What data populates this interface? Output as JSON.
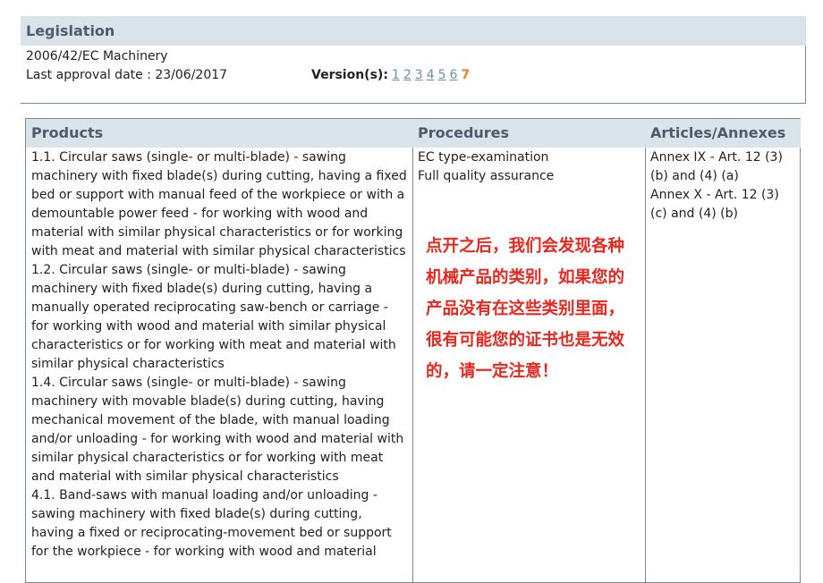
{
  "legislation": {
    "header": "Legislation",
    "directive": "2006/42/EC Machinery",
    "approval": "Last approval date : 23/06/2017",
    "versions_label": "Version(s):",
    "versions": [
      "1",
      "2",
      "3",
      "4",
      "5",
      "6"
    ],
    "current_version": "7"
  },
  "table": {
    "headers": {
      "products": "Products",
      "procedures": "Procedures",
      "articles": "Articles/Annexes"
    },
    "products": [
      "1.1. Circular saws (single- or multi-blade) - sawing machinery with fixed blade(s) during cutting, having a fixed bed or support with manual feed of the workpiece or with a demountable power feed - for working with wood and material with similar physical characteristics or for working with meat and material with similar physical characteristics",
      "1.2. Circular saws (single- or multi-blade) - sawing machinery with fixed blade(s) during cutting, having a manually operated reciprocating saw-bench or carriage - for working with wood and material with similar physical characteristics or for working with meat and material with similar physical characteristics",
      "1.4. Circular saws (single- or multi-blade) - sawing machinery with movable blade(s) during cutting, having mechanical movement of the blade, with manual loading and/or unloading - for working with wood and material with similar physical characteristics or for working with meat and material with similar physical characteristics",
      "4.1. Band-saws with manual loading and/or unloading - sawing machinery with fixed blade(s) during cutting, having a fixed or reciprocating-movement bed or support for the workpiece - for working with wood and material"
    ],
    "procedures": [
      "EC type-examination",
      "Full quality assurance"
    ],
    "articles": [
      "Annex IX - Art. 12 (3) (b) and (4) (a)",
      "Annex X - Art. 12 (3) (c) and (4) (b)"
    ]
  },
  "annotation": "点开之后，我们会发现各种机械产品的类别，如果您的产品没有在这些类别里面，很有可能您的证书也是无效的，请一定注意！"
}
